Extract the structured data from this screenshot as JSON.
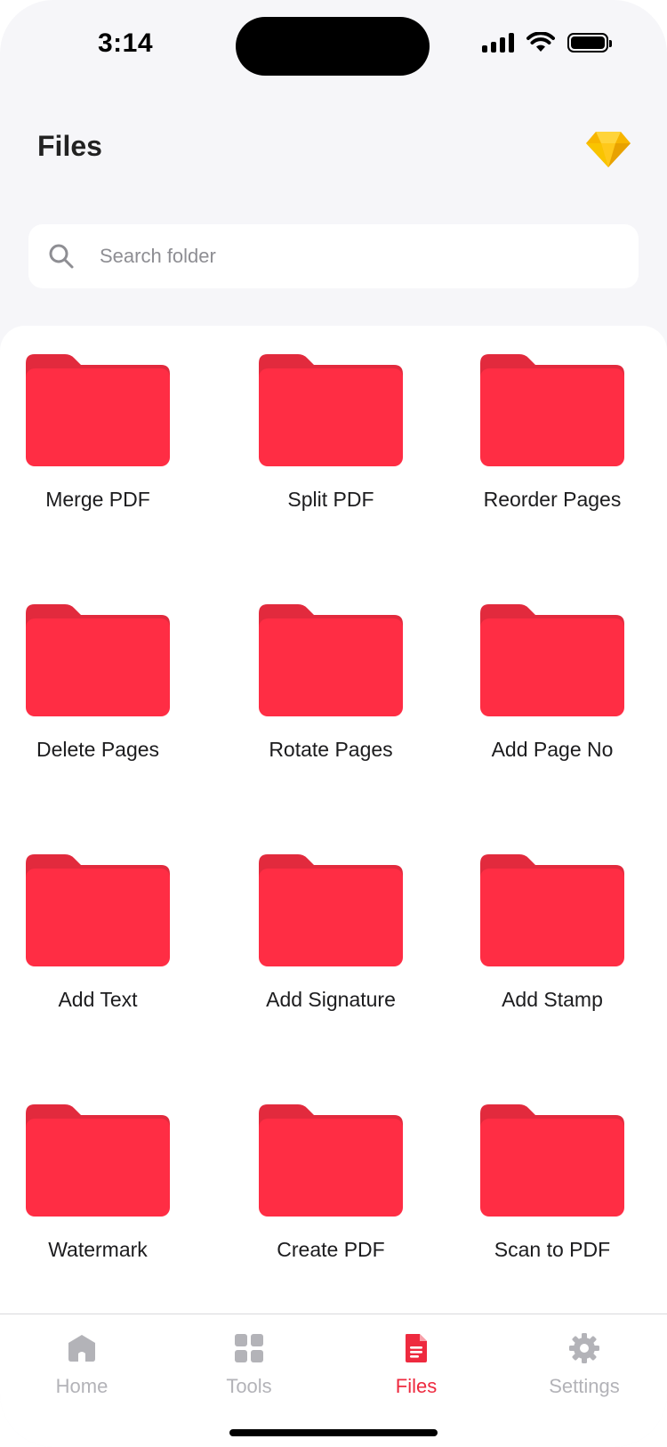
{
  "status_bar": {
    "time": "3:14"
  },
  "header": {
    "title": "Files",
    "premium_icon": "diamond-icon"
  },
  "search": {
    "placeholder": "Search folder",
    "icon": "search-icon"
  },
  "folders": [
    {
      "label": "Merge PDF"
    },
    {
      "label": "Split PDF"
    },
    {
      "label": "Reorder Pages"
    },
    {
      "label": "Delete Pages"
    },
    {
      "label": "Rotate Pages"
    },
    {
      "label": "Add Page No"
    },
    {
      "label": "Add Text"
    },
    {
      "label": "Add Signature"
    },
    {
      "label": "Add Stamp"
    },
    {
      "label": "Watermark"
    },
    {
      "label": "Create PDF"
    },
    {
      "label": "Scan to PDF"
    }
  ],
  "tab_bar": {
    "tabs": [
      {
        "label": "Home",
        "icon": "home-icon",
        "active": false
      },
      {
        "label": "Tools",
        "icon": "grid-icon",
        "active": false
      },
      {
        "label": "Files",
        "icon": "document-icon",
        "active": true
      },
      {
        "label": "Settings",
        "icon": "gear-icon",
        "active": false
      }
    ]
  },
  "colors": {
    "accent": "#ee2a3f",
    "folder_front": "#ff2d44",
    "folder_back": "#e22a3d",
    "inactive": "#b3b3b8",
    "background": "#f6f6f9"
  }
}
